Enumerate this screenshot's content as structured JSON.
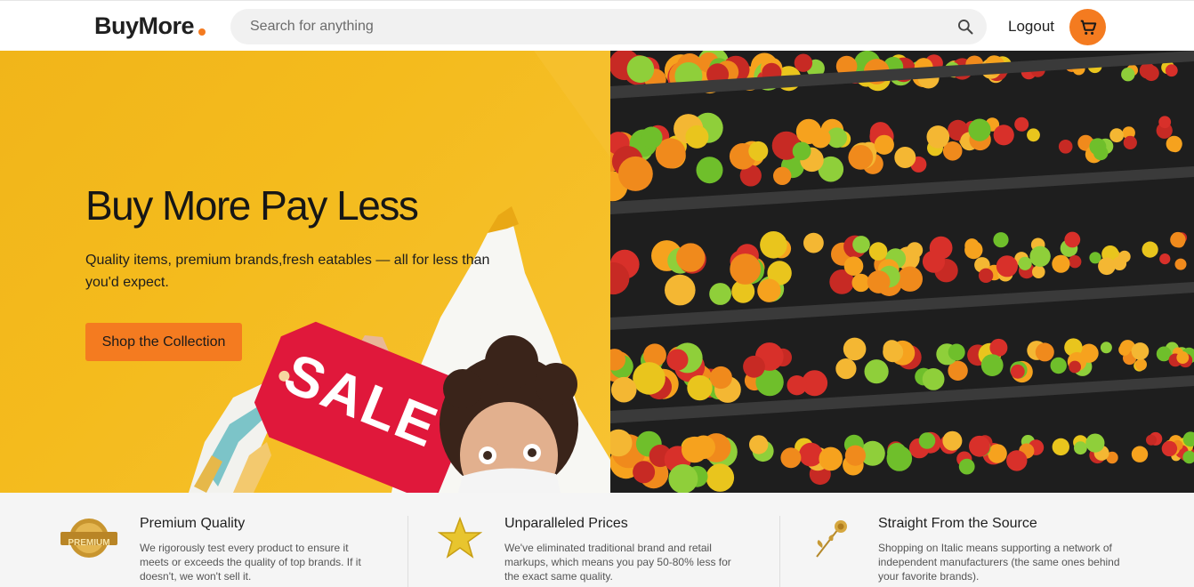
{
  "header": {
    "logo": "BuyMore",
    "search_placeholder": "Search for anything",
    "logout_label": "Logout",
    "accent_color": "#f47b20"
  },
  "hero": {
    "title": "Buy More Pay Less",
    "subtitle": "Quality items, premium brands,fresh eatables — all for less than you'd expect.",
    "cta_label": "Shop the Collection",
    "sale_tag_text": "SALE",
    "left_image": "person-holding-sale-tag",
    "right_image": "supermarket-fruit-shelves"
  },
  "features": [
    {
      "icon": "premium-badge-icon",
      "title": "Premium Quality",
      "text": "We rigorously test every product to ensure it meets or exceeds the quality of top brands. If it doesn't, we won't sell it.",
      "icon_text": "PREMIUM"
    },
    {
      "icon": "gold-star-icon",
      "title": "Unparalleled Prices",
      "text": "We've eliminated traditional brand and retail markups, which means you pay 50-80% less for the exact same quality."
    },
    {
      "icon": "golden-rose-icon",
      "title": "Straight From the Source",
      "text": "Shopping on Italic means supporting a network of independent manufacturers (the same ones behind your favorite brands)."
    }
  ]
}
